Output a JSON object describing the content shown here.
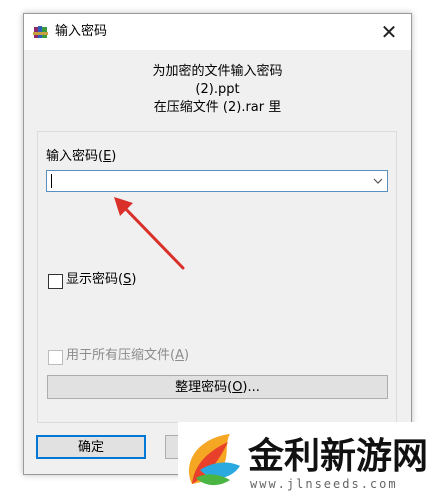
{
  "window": {
    "title": "输入密码",
    "close_glyph": "✕",
    "icon": "winrar-books-icon"
  },
  "header": {
    "line1": "为加密的文件输入密码",
    "line2": "(2).ppt",
    "line3": "在压缩文件 (2).rar 里"
  },
  "password": {
    "label_prefix": "输入密码(",
    "label_key": "E",
    "label_suffix": ")",
    "value": ""
  },
  "show_password": {
    "label_prefix": "显示密码(",
    "label_key": "S",
    "label_suffix": ")",
    "checked": false
  },
  "use_for_all": {
    "label_prefix": "用于所有压缩文件(",
    "label_key": "A",
    "label_suffix": ")",
    "checked": false,
    "disabled": true
  },
  "organize_button": {
    "label_prefix": "整理密码(",
    "label_key": "O",
    "label_suffix": ")..."
  },
  "ok_button": {
    "label": "确定"
  },
  "watermark": {
    "brand": "金利新游网",
    "url": "www.jlnseeds.com"
  },
  "colors": {
    "arrow": "#d9302a",
    "focus_border": "#0078d7"
  }
}
